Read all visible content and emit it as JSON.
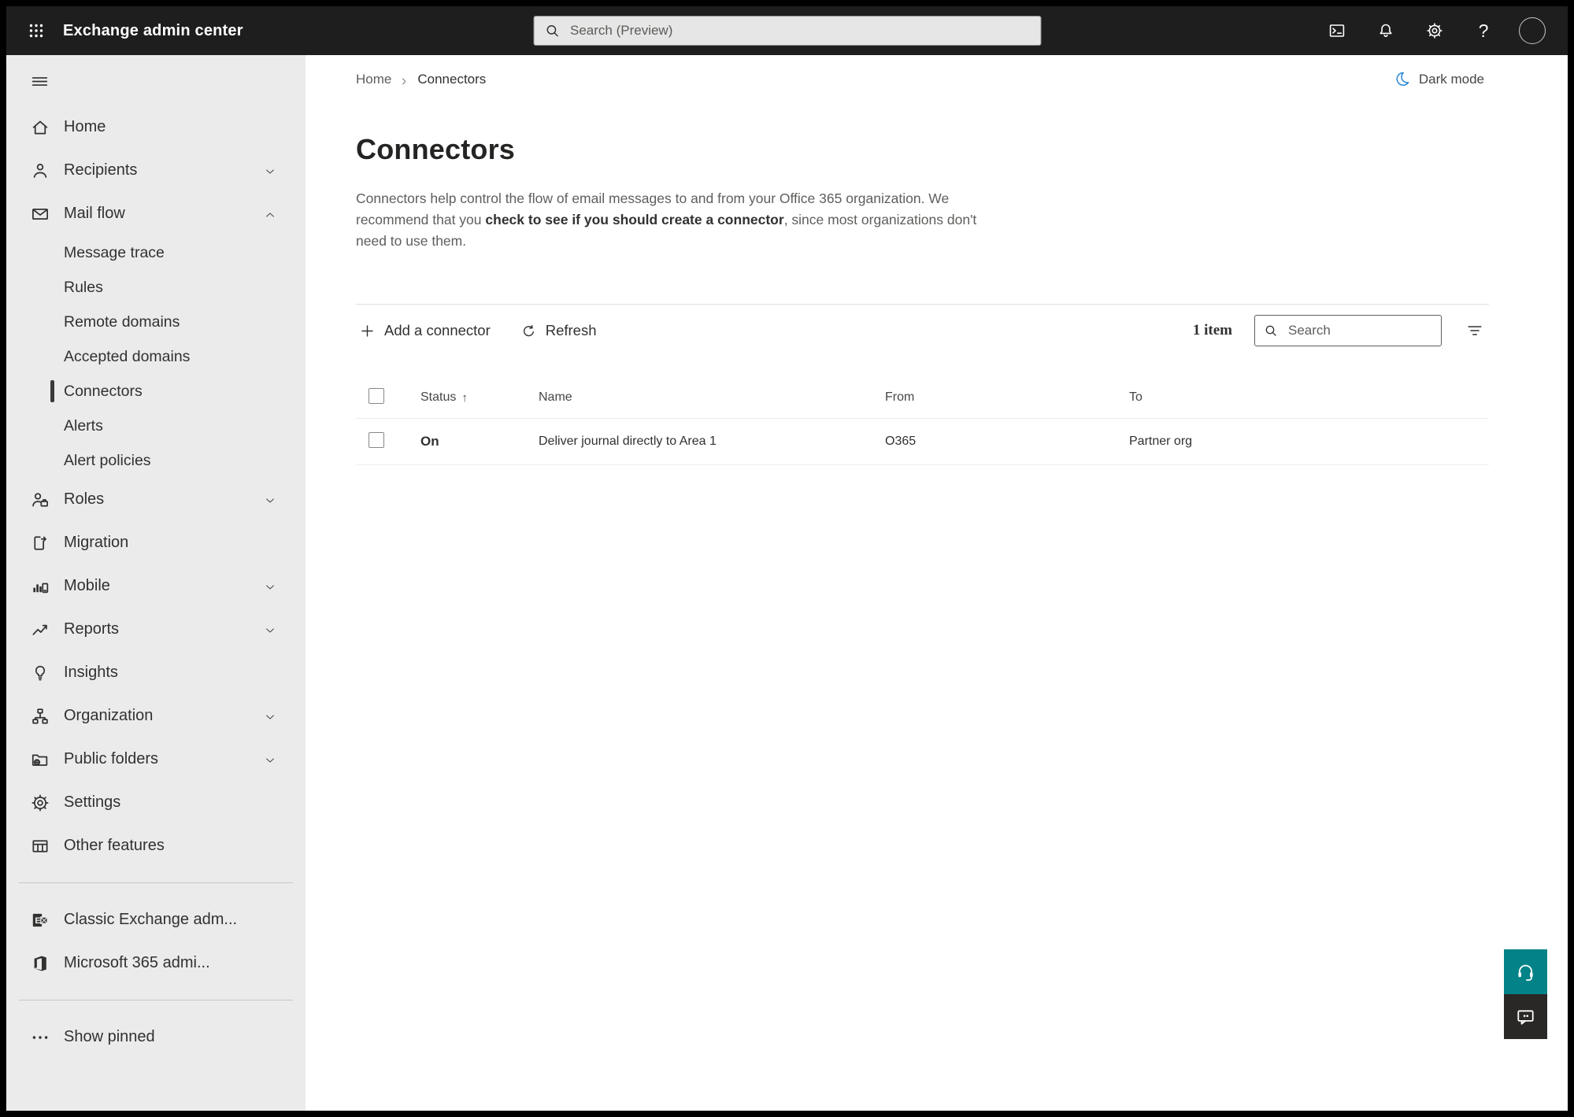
{
  "topbar": {
    "title": "Exchange admin center",
    "search_placeholder": "Search (Preview)",
    "icons": [
      "app-launcher-icon",
      "terminal-icon",
      "bell-icon",
      "gear-icon",
      "help-icon",
      "avatar"
    ]
  },
  "breadcrumb": {
    "home": "Home",
    "current": "Connectors"
  },
  "dark_mode": {
    "label": "Dark mode",
    "moon_color": "#2b88d8"
  },
  "page": {
    "title": "Connectors",
    "description_part1": "Connectors help control the flow of email messages to and from your Office 365 organization. We recommend that you ",
    "description_link": "check to see if you should create a connector",
    "description_part2": ", since most organizations don't need to use them."
  },
  "toolbar": {
    "add_label": "Add a connector",
    "refresh_label": "Refresh",
    "items_count": "1 item",
    "search_placeholder": "Search"
  },
  "table": {
    "columns": [
      {
        "key": "status",
        "label": "Status",
        "sorted": "asc"
      },
      {
        "key": "name",
        "label": "Name"
      },
      {
        "key": "from",
        "label": "From"
      },
      {
        "key": "to",
        "label": "To"
      }
    ],
    "rows": [
      {
        "status": "On",
        "name": "Deliver journal directly to Area 1",
        "from": "O365",
        "to": "Partner org"
      }
    ]
  },
  "sidebar": {
    "items": [
      {
        "id": "home",
        "label": "Home",
        "icon": "home-icon",
        "type": "top"
      },
      {
        "id": "recipients",
        "label": "Recipients",
        "icon": "person-icon",
        "type": "top",
        "chevron": "down"
      },
      {
        "id": "mail-flow",
        "label": "Mail flow",
        "icon": "mail-icon",
        "type": "top",
        "chevron": "up"
      },
      {
        "id": "message-trace",
        "label": "Message trace",
        "type": "sub"
      },
      {
        "id": "rules",
        "label": "Rules",
        "type": "sub"
      },
      {
        "id": "remote-domains",
        "label": "Remote domains",
        "type": "sub"
      },
      {
        "id": "accepted-domains",
        "label": "Accepted domains",
        "type": "sub"
      },
      {
        "id": "connectors",
        "label": "Connectors",
        "type": "sub",
        "selected": true
      },
      {
        "id": "alerts",
        "label": "Alerts",
        "type": "sub"
      },
      {
        "id": "alert-policies",
        "label": "Alert policies",
        "type": "sub"
      },
      {
        "id": "roles",
        "label": "Roles",
        "icon": "roles-icon",
        "type": "top",
        "chevron": "down"
      },
      {
        "id": "migration",
        "label": "Migration",
        "icon": "migration-icon",
        "type": "top"
      },
      {
        "id": "mobile",
        "label": "Mobile",
        "icon": "mobile-icon",
        "type": "top",
        "chevron": "down"
      },
      {
        "id": "reports",
        "label": "Reports",
        "icon": "reports-icon",
        "type": "top",
        "chevron": "down"
      },
      {
        "id": "insights",
        "label": "Insights",
        "icon": "insights-icon",
        "type": "top"
      },
      {
        "id": "organization",
        "label": "Organization",
        "icon": "organization-icon",
        "type": "top",
        "chevron": "down"
      },
      {
        "id": "public-folders",
        "label": "Public folders",
        "icon": "public-folders-icon",
        "type": "top",
        "chevron": "down"
      },
      {
        "id": "settings",
        "label": "Settings",
        "icon": "settings-icon",
        "type": "top"
      },
      {
        "id": "other-features",
        "label": "Other features",
        "icon": "other-features-icon",
        "type": "top"
      },
      {
        "id": "classic-exchange",
        "label": "Classic Exchange adm...",
        "icon": "classic-exchange-icon",
        "type": "top",
        "divider_before": true
      },
      {
        "id": "microsoft-365",
        "label": "Microsoft 365 admi...",
        "icon": "microsoft-365-icon",
        "type": "top"
      },
      {
        "id": "show-pinned",
        "label": "Show pinned",
        "icon": "more-icon",
        "type": "top",
        "divider_before": true
      }
    ]
  },
  "floating_buttons": [
    {
      "id": "help",
      "icon": "headset-icon",
      "color": "#038387"
    },
    {
      "id": "feedback",
      "icon": "feedback-icon",
      "color": "#292827"
    }
  ],
  "colors": {
    "topbar_bg": "#1f1e1e",
    "sidebar_bg": "#ebebeb",
    "selected_indicator": "#3b3a39",
    "text_primary": "#323130",
    "text_secondary": "#605e5c",
    "accent_teal": "#038387",
    "moon_blue": "#2b88d8"
  }
}
